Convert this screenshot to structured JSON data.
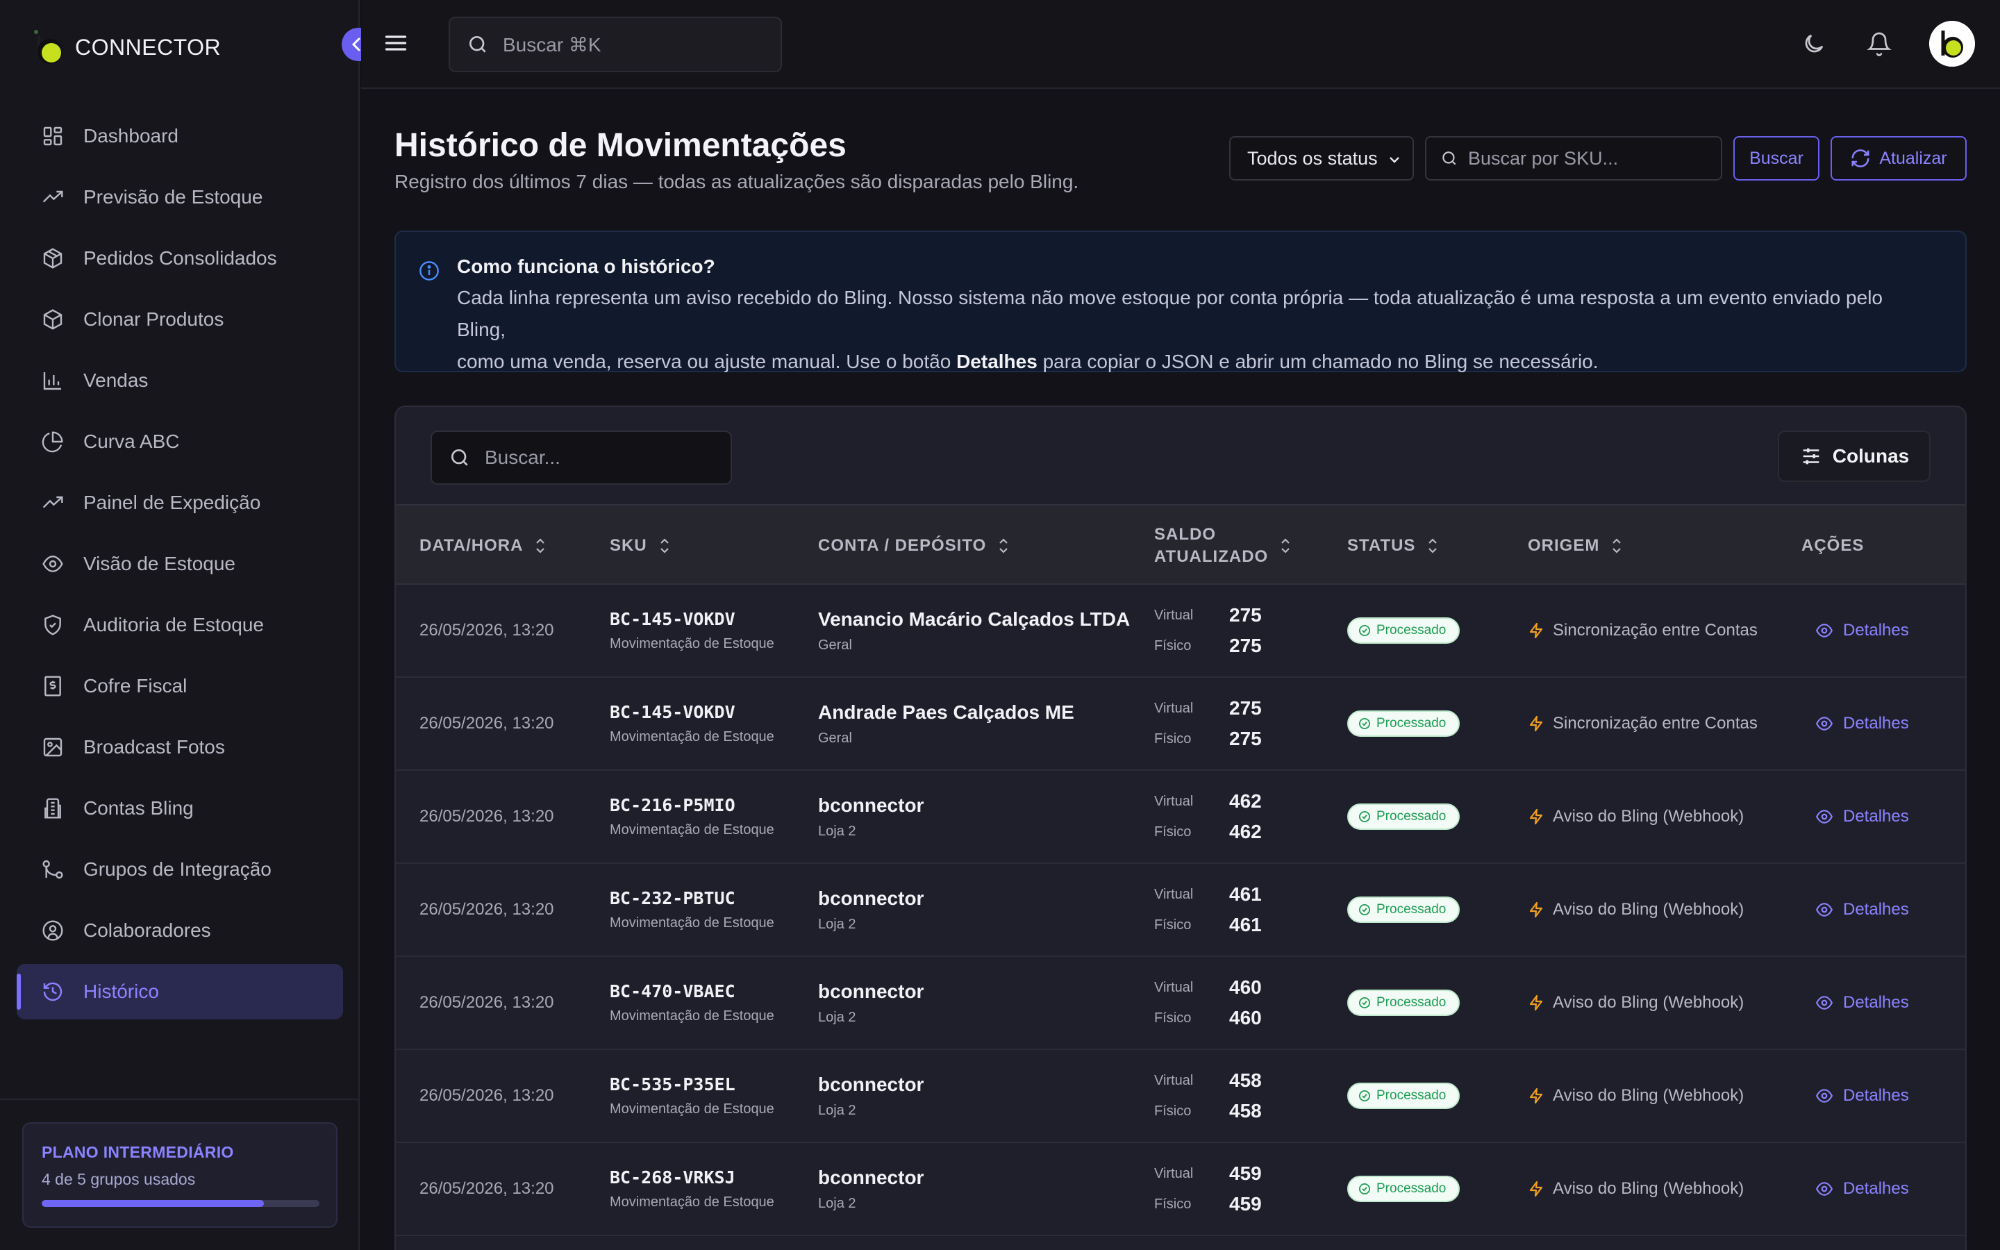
{
  "app": {
    "name": "CONNECTOR"
  },
  "sidebar": {
    "items": [
      {
        "label": "Dashboard",
        "icon": "dashboard-icon"
      },
      {
        "label": "Previsão de Estoque",
        "icon": "trending-up-icon"
      },
      {
        "label": "Pedidos Consolidados",
        "icon": "package-icon"
      },
      {
        "label": "Clonar Produtos",
        "icon": "box-icon"
      },
      {
        "label": "Vendas",
        "icon": "bar-chart-icon"
      },
      {
        "label": "Curva ABC",
        "icon": "pie-chart-icon"
      },
      {
        "label": "Painel de Expedição",
        "icon": "trending-up-icon"
      },
      {
        "label": "Visão de Estoque",
        "icon": "eye-icon"
      },
      {
        "label": "Auditoria de Estoque",
        "icon": "shield-check-icon"
      },
      {
        "label": "Cofre Fiscal",
        "icon": "receipt-icon"
      },
      {
        "label": "Broadcast Fotos",
        "icon": "image-icon"
      },
      {
        "label": "Contas Bling",
        "icon": "building-icon"
      },
      {
        "label": "Grupos de Integração",
        "icon": "git-branch-icon"
      },
      {
        "label": "Colaboradores",
        "icon": "user-circle-icon"
      },
      {
        "label": "Histórico",
        "icon": "history-icon",
        "active": true
      }
    ],
    "plan": {
      "title": "PLANO INTERMEDIÁRIO",
      "usage": "4 de 5 grupos usados",
      "progress": 0.8
    }
  },
  "topbar": {
    "search_placeholder": "Buscar ⌘K"
  },
  "page": {
    "title": "Histórico de Movimentações",
    "subtitle": "Registro dos últimos 7 dias — todas as atualizações são disparadas pelo Bling.",
    "status_filter": "Todos os status",
    "sku_placeholder": "Buscar por SKU...",
    "buscar_label": "Buscar",
    "atualizar_label": "Atualizar"
  },
  "info": {
    "title": "Como funciona o histórico?",
    "text_1": "Cada linha representa um aviso recebido do Bling. Nosso sistema não move estoque por conta própria — toda atualização é uma resposta a um evento enviado pelo Bling,",
    "text_2a": "como uma venda, reserva ou ajuste manual. Use o botão ",
    "text_2b": "Detalhes",
    "text_2c": " para copiar o JSON e abrir um chamado no Bling se necessário."
  },
  "table": {
    "search_placeholder": "Buscar...",
    "columns_label": "Colunas",
    "headers": {
      "date": "DATA/HORA",
      "sku": "SKU",
      "account": "CONTA / DEPÓSITO",
      "saldo_1": "SALDO",
      "saldo_2": "ATUALIZADO",
      "status": "STATUS",
      "origin": "ORIGEM",
      "actions": "AÇÕES"
    },
    "labels": {
      "virtual": "Virtual",
      "fisico": "Físico",
      "detalhes": "Detalhes"
    },
    "rows": [
      {
        "date": "26/05/2026, 13:20",
        "sku": "BC-145-VOKDV",
        "type": "Movimentação de Estoque",
        "account": "Venancio Macário Calçados LTDA",
        "deposit": "Geral",
        "virtual": "275",
        "fisico": "275",
        "status": "Processado",
        "origin": "Sincronização entre Contas"
      },
      {
        "date": "26/05/2026, 13:20",
        "sku": "BC-145-VOKDV",
        "type": "Movimentação de Estoque",
        "account": "Andrade Paes Calçados ME",
        "deposit": "Geral",
        "virtual": "275",
        "fisico": "275",
        "status": "Processado",
        "origin": "Sincronização entre Contas"
      },
      {
        "date": "26/05/2026, 13:20",
        "sku": "BC-216-P5MIO",
        "type": "Movimentação de Estoque",
        "account": "bconnector",
        "deposit": "Loja 2",
        "virtual": "462",
        "fisico": "462",
        "status": "Processado",
        "origin": "Aviso do Bling (Webhook)"
      },
      {
        "date": "26/05/2026, 13:20",
        "sku": "BC-232-PBTUC",
        "type": "Movimentação de Estoque",
        "account": "bconnector",
        "deposit": "Loja 2",
        "virtual": "461",
        "fisico": "461",
        "status": "Processado",
        "origin": "Aviso do Bling (Webhook)"
      },
      {
        "date": "26/05/2026, 13:20",
        "sku": "BC-470-VBAEC",
        "type": "Movimentação de Estoque",
        "account": "bconnector",
        "deposit": "Loja 2",
        "virtual": "460",
        "fisico": "460",
        "status": "Processado",
        "origin": "Aviso do Bling (Webhook)"
      },
      {
        "date": "26/05/2026, 13:20",
        "sku": "BC-535-P35EL",
        "type": "Movimentação de Estoque",
        "account": "bconnector",
        "deposit": "Loja 2",
        "virtual": "458",
        "fisico": "458",
        "status": "Processado",
        "origin": "Aviso do Bling (Webhook)"
      },
      {
        "date": "26/05/2026, 13:20",
        "sku": "BC-268-VRKSJ",
        "type": "Movimentação de Estoque",
        "account": "bconnector",
        "deposit": "Loja 2",
        "virtual": "459",
        "fisico": "459",
        "status": "Processado",
        "origin": "Aviso do Bling (Webhook)"
      }
    ]
  },
  "colors": {
    "accent": "#7a70ff",
    "success": "#1f9d55",
    "brand_dot": "#c6e020"
  }
}
